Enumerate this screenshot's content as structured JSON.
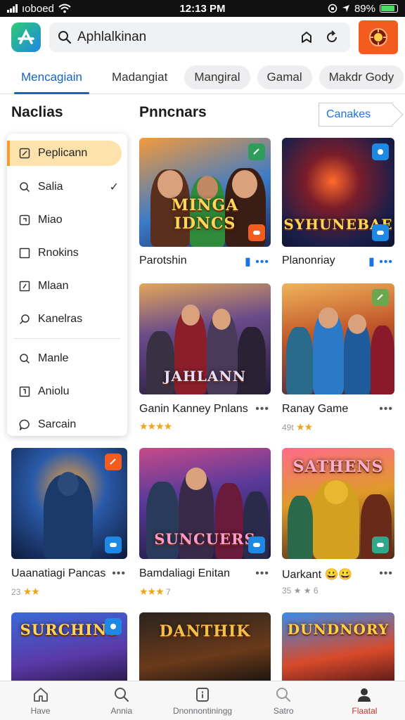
{
  "status": {
    "carrier": "ıoboed",
    "time": "12:13 PM",
    "battery": "89%"
  },
  "header": {
    "search_value": "Aphlalkinan"
  },
  "tabs": [
    {
      "label": "Mencagiain",
      "active": true
    },
    {
      "label": "Madangiat"
    },
    {
      "label": "Mangiral"
    },
    {
      "label": "Gamal"
    },
    {
      "label": "Makdr Gody"
    }
  ],
  "sidebar": {
    "title": "Naclias"
  },
  "main": {
    "title": "Pnncnars",
    "filter_label": "Canakes"
  },
  "menu": {
    "items": [
      {
        "label": "Peplicann",
        "icon": "edit-icon"
      },
      {
        "label": "Salia",
        "icon": "search-icon",
        "checked": true
      },
      {
        "label": "Miao",
        "icon": "copy-icon"
      },
      {
        "label": "Rnokins",
        "icon": "square-icon"
      },
      {
        "label": "Mlaan",
        "icon": "pen-square-icon"
      },
      {
        "label": "Kanelras",
        "icon": "magnify-icon"
      },
      {
        "label": "Manle",
        "icon": "search-icon"
      },
      {
        "label": "Aniolu",
        "icon": "bracket-icon"
      },
      {
        "label": "Sarcain",
        "icon": "bubble-icon"
      }
    ]
  },
  "games": [
    {
      "title": "Parotshin",
      "art_text": "MINGA IDNCS",
      "rating": "",
      "sub": ""
    },
    {
      "title": "Planonriay",
      "art_text": "SYHUNEBAE",
      "rating": "",
      "sub": ""
    },
    {
      "title": "Ganin Kanney Pnlans",
      "art_text": "JAHLANN",
      "rating": "★★★★",
      "sub": ""
    },
    {
      "title": "Ranay Game",
      "art_text": "",
      "rating": "★★",
      "sub": "49t"
    },
    {
      "title": "Uaanatiagi Pancas",
      "art_text": "",
      "rating": "★★",
      "sub": "23"
    },
    {
      "title": "Bamdaliagi Enitan",
      "art_text": "SUNCUERS",
      "rating": "★★★",
      "sub": "7"
    },
    {
      "title": "Uarkant 😀😀",
      "art_text": "SATHENS",
      "rating": "",
      "sub": "35 ★ ★ 6"
    },
    {
      "title": "",
      "art_text": "SURCHINS",
      "rating": "",
      "sub": ""
    },
    {
      "title": "",
      "art_text": "DANTHIK",
      "rating": "",
      "sub": ""
    },
    {
      "title": "",
      "art_text": "DUNDNORY",
      "rating": "",
      "sub": ""
    }
  ],
  "bottomnav": [
    {
      "label": "Have",
      "icon": "home-icon"
    },
    {
      "label": "Annia",
      "icon": "search-icon"
    },
    {
      "label": "Dnonnontiningg",
      "icon": "info-card-icon"
    },
    {
      "label": "Satro",
      "icon": "search-icon"
    },
    {
      "label": "Flaatal",
      "icon": "profile-icon",
      "active": true
    }
  ],
  "colors": {
    "accent": "#1565c0",
    "brand_orange": "#f25c1f",
    "highlight": "#fde2ac",
    "star": "#f0a41c"
  }
}
